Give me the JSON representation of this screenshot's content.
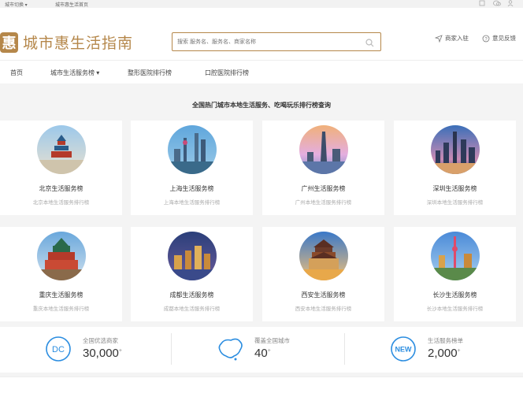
{
  "topbar": {
    "city_switch": "城市切换",
    "home": "城市惠生活首页"
  },
  "logo": {
    "mark": "惠",
    "text": "城市惠生活指南"
  },
  "search": {
    "placeholder": "搜索 服务名、服务名、商家名称"
  },
  "header_links": {
    "merchant": "商家入驻",
    "feedback": "意见反馈"
  },
  "nav": [
    "首页",
    "城市生活服务榜",
    "整形医院排行榜",
    "口腔医院排行榜"
  ],
  "subtitle": "全国热门城市本地生活服务、吃喝玩乐排行榜查询",
  "cities": [
    {
      "name": "北京生活服务榜",
      "desc": "北京本地生活服务排行榜"
    },
    {
      "name": "上海生活服务榜",
      "desc": "上海本地生活服务排行榜"
    },
    {
      "name": "广州生活服务榜",
      "desc": "广州本地生活服务排行榜"
    },
    {
      "name": "深圳生活服务榜",
      "desc": "深圳本地生活服务排行榜"
    },
    {
      "name": "重庆生活服务榜",
      "desc": "重庆本地生活服务排行榜"
    },
    {
      "name": "成都生活服务榜",
      "desc": "成都本地生活服务排行榜"
    },
    {
      "name": "西安生活服务榜",
      "desc": "西安本地生活服务排行榜"
    },
    {
      "name": "长沙生活服务榜",
      "desc": "长沙本地生活服务排行榜"
    }
  ],
  "stats": [
    {
      "label": "全国优选商家",
      "value": "30,000",
      "suffix": "+",
      "icon": "dc-icon"
    },
    {
      "label": "覆盖全国城市",
      "value": "40",
      "suffix": "+",
      "icon": "china-map-icon"
    },
    {
      "label": "生活服务榜单",
      "value": "2,000",
      "suffix": "+",
      "icon": "new-badge-icon",
      "badge": "NEW"
    }
  ],
  "colors": {
    "brand": "#b5874a",
    "stat_icon": "#2b8de0"
  }
}
